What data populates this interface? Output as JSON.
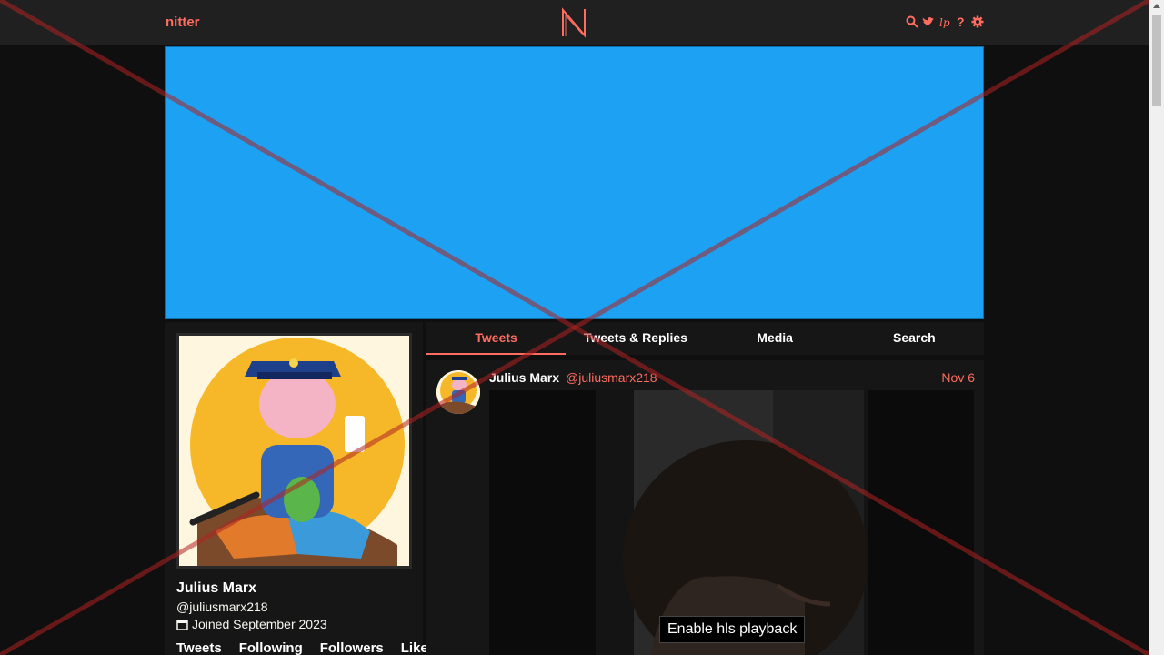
{
  "nav": {
    "brand": "nitter",
    "icons": [
      "search-icon",
      "bird-icon",
      "rss-icon",
      "help-icon",
      "settings-icon"
    ]
  },
  "profile": {
    "fullname": "Julius Marx",
    "username": "@juliusmarx218",
    "joined": "Joined September 2023",
    "stats": [
      "Tweets",
      "Following",
      "Followers",
      "Likes"
    ]
  },
  "tabs": [
    "Tweets",
    "Tweets & Replies",
    "Media",
    "Search"
  ],
  "tweet": {
    "name": "Julius Marx",
    "handle": "@juliusmarx218",
    "date": "Nov 6",
    "video_button": "Enable hls playback"
  },
  "colors": {
    "accent": "#ff6c60",
    "banner": "#1da1f2",
    "background": "#0f0f0f",
    "panel": "#161616"
  }
}
